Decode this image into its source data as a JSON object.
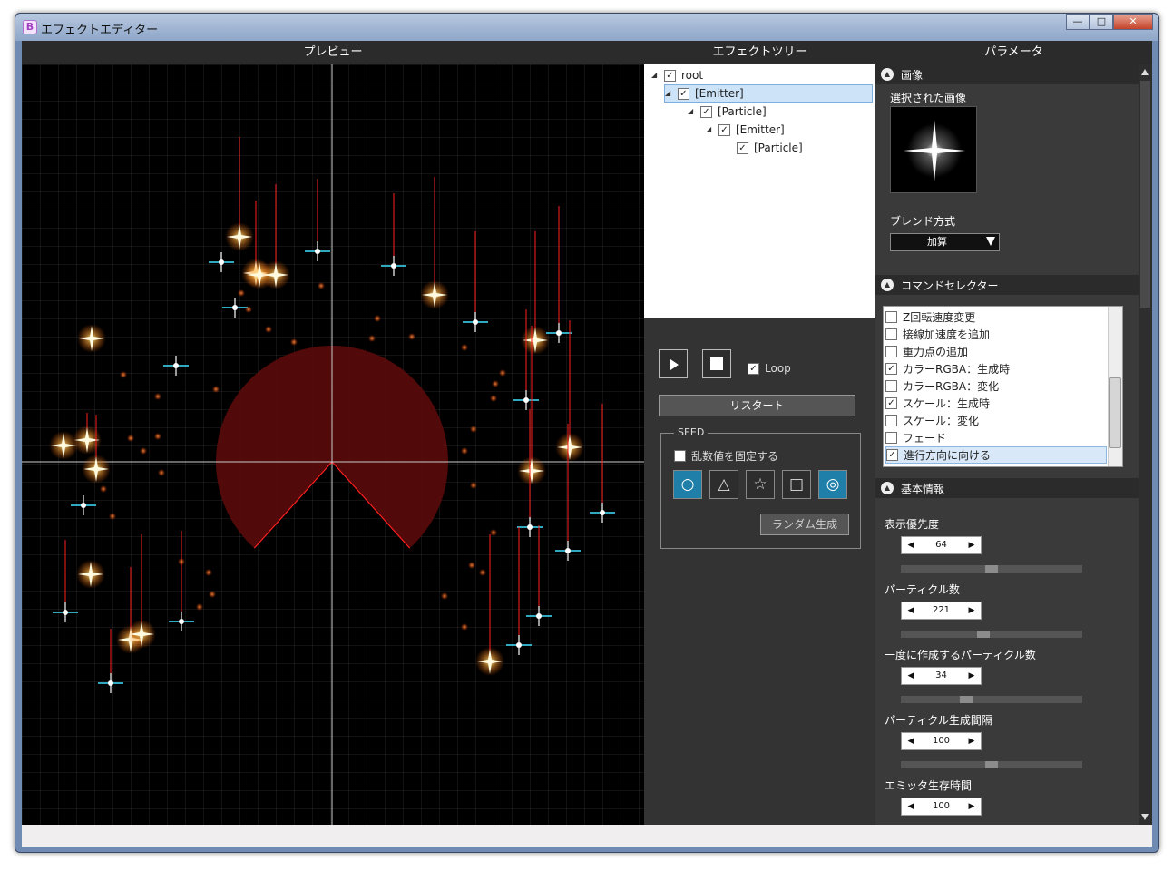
{
  "window": {
    "title": "エフェクトエディター",
    "icon_glyph": "B",
    "minimize": "—",
    "maximize": "□",
    "close": "✕"
  },
  "headers": {
    "preview": "プレビュー",
    "tree": "エフェクトツリー",
    "params": "パラメータ"
  },
  "tree": {
    "nodes": [
      {
        "label": "root",
        "checked": "✓"
      },
      {
        "label": "[Emitter]",
        "checked": "✓"
      },
      {
        "label": "[Particle]",
        "checked": "✓"
      },
      {
        "label": "[Emitter]",
        "checked": "✓"
      },
      {
        "label": "[Particle]",
        "checked": "✓"
      }
    ]
  },
  "controls": {
    "loop_label": "Loop",
    "loop_check": "✓",
    "restart_label": "リスタート",
    "seed_legend": "SEED",
    "seed_fix_label": "乱数値を固定する",
    "shapes": [
      "○",
      "△",
      "☆",
      "□",
      "◎"
    ],
    "random_label": "ランダム生成"
  },
  "params": {
    "image_section": "画像",
    "selected_image_label": "選択された画像",
    "blend_label": "ブレンド方式",
    "blend_value": "加算",
    "command_section": "コマンドセレクター",
    "commands": [
      {
        "label": "Z回転速度変更",
        "checked": ""
      },
      {
        "label": "接線加速度を追加",
        "checked": ""
      },
      {
        "label": "重力点の追加",
        "checked": ""
      },
      {
        "label": "カラーRGBA：生成時",
        "checked": "✓"
      },
      {
        "label": "カラーRGBA：変化",
        "checked": ""
      },
      {
        "label": "スケール：生成時",
        "checked": "✓"
      },
      {
        "label": "スケール：変化",
        "checked": ""
      },
      {
        "label": "フェード",
        "checked": ""
      },
      {
        "label": "進行方向に向ける",
        "checked": "✓"
      }
    ],
    "basic_section": "基本情報",
    "fields": [
      {
        "label": "表示優先度",
        "value": "64",
        "slider_fraction": 0.5
      },
      {
        "label": "パーティクル数",
        "value": "221",
        "slider_fraction": 0.45
      },
      {
        "label": "一度に作成するパーティクル数",
        "value": "34",
        "slider_fraction": 0.35
      },
      {
        "label": "パーティクル生成間隔",
        "value": "100",
        "slider_fraction": 0.5
      },
      {
        "label": "エミッタ生存時間",
        "value": "100",
        "slider_fraction": 0.5
      }
    ]
  },
  "colors": {
    "accent": "#1f7fa8",
    "emitter_area": "#5a0a0a",
    "trail": "#ff2020",
    "cyan_particle": "#40e0ff",
    "gold_particle": "#ffd870"
  },
  "icons": {
    "play": "play-icon",
    "stop": "stop-icon",
    "collapse": "chevron-up-icon"
  }
}
